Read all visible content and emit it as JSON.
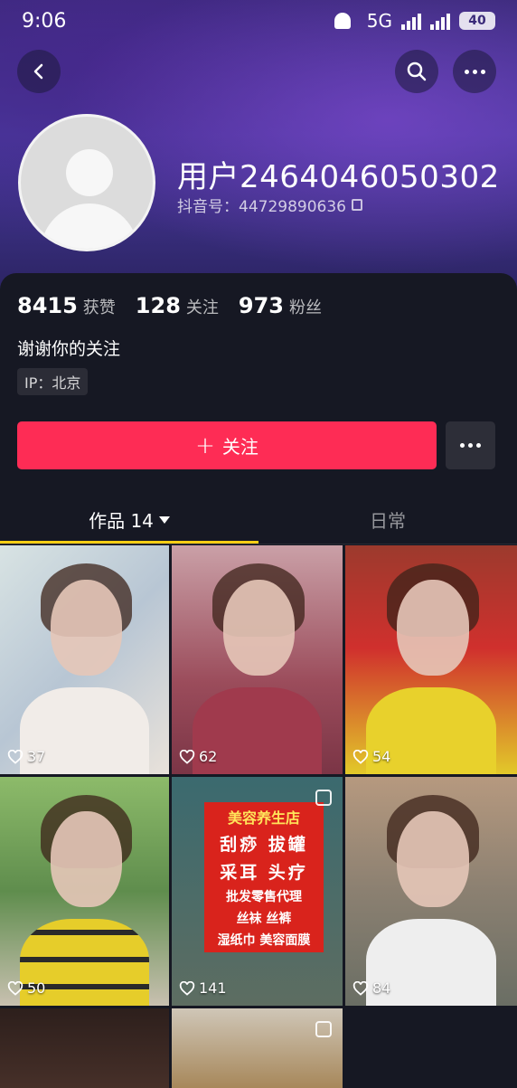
{
  "status_bar": {
    "time": "9:06",
    "network": "5G",
    "battery": "40"
  },
  "profile": {
    "username": "用户2464046050302",
    "douyin_id": "抖音号：44729890636",
    "bio": "谢谢你的关注",
    "ip": "IP：北京"
  },
  "stats": [
    {
      "value": "8415",
      "label": "获赞"
    },
    {
      "value": "128",
      "label": "关注"
    },
    {
      "value": "973",
      "label": "粉丝"
    }
  ],
  "actions": {
    "follow_label": "关注"
  },
  "tabs": {
    "works_label": "作品 14",
    "daily_label": "日常"
  },
  "videos": [
    {
      "likes": "37"
    },
    {
      "likes": "62"
    },
    {
      "likes": "54"
    },
    {
      "likes": "50"
    },
    {
      "likes": "141"
    },
    {
      "likes": "84"
    }
  ],
  "sign": {
    "title": "美容养生店",
    "line1": "刮痧 拔罐",
    "line2": "采耳 头疗",
    "line3": "批发零售代理",
    "line4": "丝袜 丝裤",
    "line5": "湿纸巾 美容面膜"
  },
  "colors": {
    "accent": "#fe2c55",
    "tab_indicator": "#face15",
    "background": "#161823"
  },
  "icons": [
    "back-icon",
    "search-icon",
    "more-icon",
    "copy-icon",
    "heart-icon",
    "pin-icon",
    "plus-icon"
  ]
}
